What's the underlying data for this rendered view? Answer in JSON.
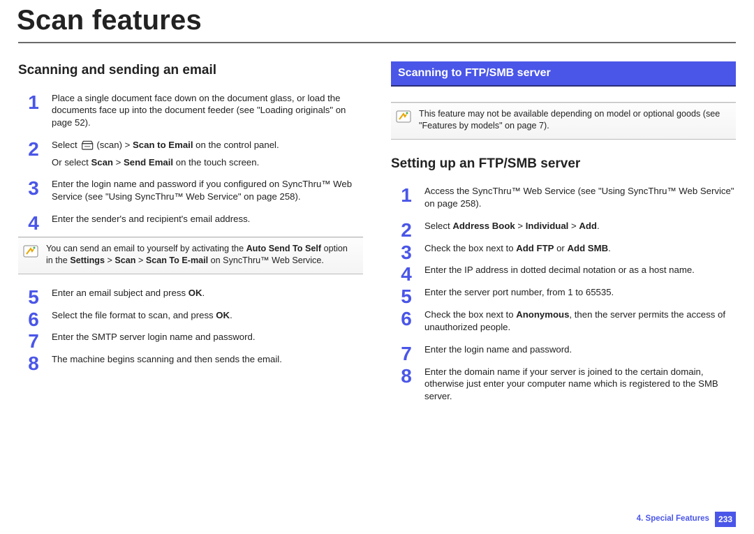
{
  "title": "Scan features",
  "left": {
    "heading": "Scanning and sending an email",
    "steps": [
      {
        "text": "Place a single document face down on the document glass, or load the documents face up into the document feeder (see \"Loading originals\" on page 52)."
      },
      {
        "html": "Select {scanIcon}(scan) > <b>Scan to Email</b> on the control panel.",
        "text2": "Or select <b>Scan</b> > <b>Send Email</b> on the touch screen."
      },
      {
        "text": "Enter the login name and password if you configured on SyncThru™ Web Service (see \"Using SyncThru™ Web Service\" on page 258)."
      },
      {
        "text": "Enter the sender's and recipient's email address."
      }
    ],
    "note": "You can send an email to yourself by activating the <b>Auto Send To Self</b> option in the <b>Settings</b> > <b>Scan</b> > <b>Scan To E-mail</b> on SyncThru™ Web Service.",
    "steps2": [
      {
        "html": "Enter an email subject and press <b>OK</b>."
      },
      {
        "html": "Select the file format to scan, and press <b>OK</b>."
      },
      {
        "text": "Enter the SMTP server login name and password."
      },
      {
        "text": "The machine begins scanning and then sends the email."
      }
    ]
  },
  "right": {
    "bluebar": "Scanning to FTP/SMB server",
    "note": "This feature may not be available depending on model or optional goods (see \"Features by models\" on page 7).",
    "heading": "Setting up an FTP/SMB server",
    "steps": [
      {
        "text": "Access the SyncThru™ Web Service (see \"Using SyncThru™ Web Service\" on page 258)."
      },
      {
        "html": "Select <b>Address Book</b> > <b>Individual</b> > <b>Add</b>."
      },
      {
        "html": "Check the box next to <b>Add FTP</b> or <b>Add SMB</b>."
      },
      {
        "text": "Enter the IP address in dotted decimal notation or as a host name."
      },
      {
        "text": "Enter the server port number, from 1 to 65535."
      },
      {
        "html": "Check the box next to <b>Anonymous</b>, then the server permits the access of unauthorized people."
      },
      {
        "text": "Enter the login name and password."
      },
      {
        "text": "Enter the domain name if your server is joined to the certain domain, otherwise just enter your computer name which is registered to the SMB server."
      }
    ]
  },
  "footer": {
    "chapter": "4.  Special Features",
    "page": "233"
  }
}
